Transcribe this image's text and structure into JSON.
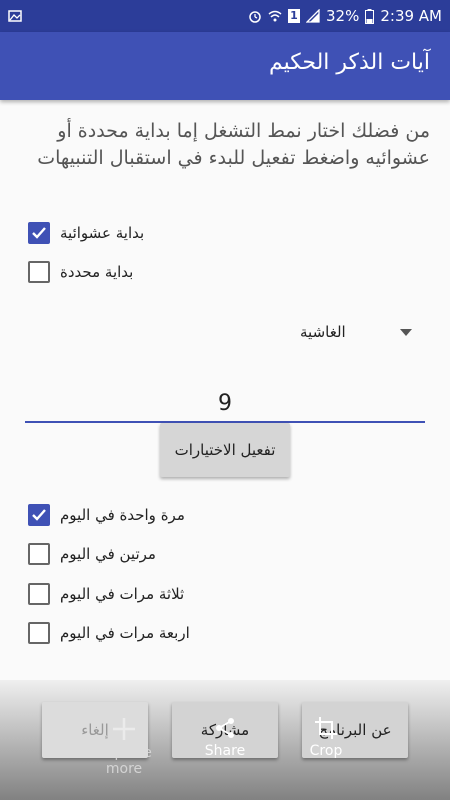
{
  "status_bar": {
    "battery": "32%",
    "time": "2:39 AM",
    "sim_badge": "1"
  },
  "app_bar": {
    "title": "آيات الذكر الحكيم"
  },
  "instructions": "من فضلك اختار نمط التشغل إما بداية محددة أو عشوائيه واضغط تفعيل للبدء في استقبال التنبيهات",
  "start_mode": [
    {
      "label": "بداية عشوائية",
      "checked": true
    },
    {
      "label": "بداية محددة",
      "checked": false
    }
  ],
  "surah_dropdown": {
    "selected": "الغاشية"
  },
  "number_field": {
    "value": "9"
  },
  "activate_button": {
    "label": "تفعيل الاختيارات"
  },
  "frequency": [
    {
      "label": "مرة واحدة في اليوم",
      "checked": true
    },
    {
      "label": "مرتين في اليوم",
      "checked": false
    },
    {
      "label": "ثلاثة مرات في اليوم",
      "checked": false
    },
    {
      "label": "اربعة مرات في اليوم",
      "checked": false
    }
  ],
  "bottom_buttons": {
    "cancel": "إلغاء",
    "share": "مشاركة",
    "about": "عن البرنامج"
  },
  "capture_overlay": {
    "capture_more": "Capture\nmore",
    "share": "Share",
    "crop": "Crop"
  },
  "colors": {
    "status_bar": "#2c3d99",
    "app_bar": "#3f51b5",
    "accent": "#3f51b5"
  }
}
